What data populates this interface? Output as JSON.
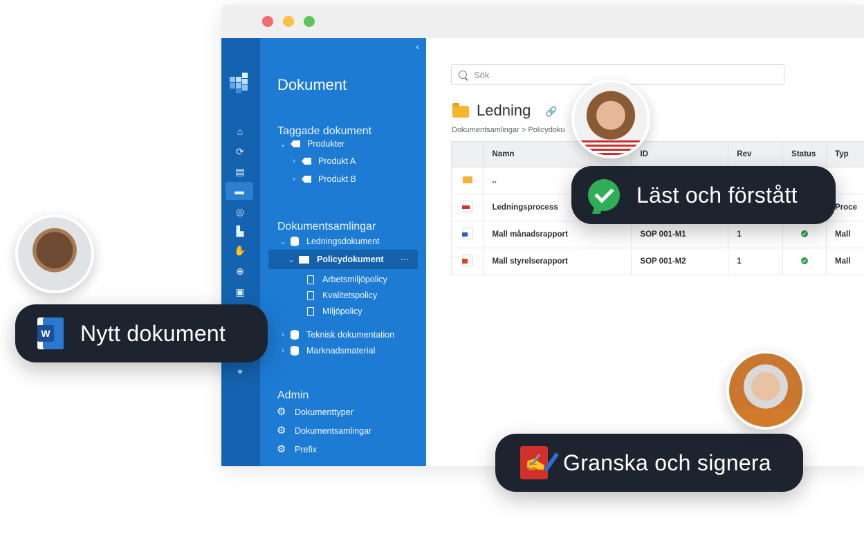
{
  "sidebar": {
    "title": "Dokument",
    "collapse_icon": "‹",
    "tagged": {
      "heading": "Taggade dokument",
      "items": [
        {
          "label": "Produkter"
        },
        {
          "label": "Produkt A"
        },
        {
          "label": "Produkt B"
        }
      ]
    },
    "collections": {
      "heading": "Dokumentsamlingar",
      "items": [
        {
          "label": "Ledningsdokument"
        },
        {
          "label": "Policydokument",
          "more": "···"
        },
        {
          "label": "Arbetsmiljöpolicy"
        },
        {
          "label": "Kvalitetspolicy"
        },
        {
          "label": "Miljöpolicy"
        },
        {
          "label": "Teknisk dokumentation"
        },
        {
          "label": "Marknadsmaterial"
        }
      ]
    },
    "admin": {
      "heading": "Admin",
      "items": [
        {
          "label": "Dokumenttyper"
        },
        {
          "label": "Dokumentsamlingar"
        },
        {
          "label": "Prefix"
        }
      ]
    }
  },
  "search": {
    "placeholder": "Sök"
  },
  "folder": {
    "title": "Ledning",
    "breadcrumb": "Dokumentsamlingar  >  Policydoku"
  },
  "table": {
    "headers": {
      "name": "Namn",
      "id": "ID",
      "rev": "Rev",
      "status": "Status",
      "type": "Typ"
    },
    "rows": [
      {
        "icon": "folder-icon",
        "name": "..",
        "id": "",
        "rev": "",
        "type": ""
      },
      {
        "icon": "pdf-icon",
        "name": "Ledningsprocess",
        "id": "",
        "rev": "",
        "type": "Proce"
      },
      {
        "icon": "word-icon",
        "name": "Mall månadsrapport",
        "id": "SOP 001-M1",
        "rev": "1",
        "type": "Mall"
      },
      {
        "icon": "powerpoint-icon",
        "name": "Mall styrelserapport",
        "id": "SOP 001-M2",
        "rev": "1",
        "type": "Mall"
      }
    ]
  },
  "pills": {
    "new_document": "Nytt dokument",
    "read_understood": "Läst och förstått",
    "review_sign": "Granska och signera"
  },
  "colors": {
    "rail": "#1463b0",
    "sidebar": "#1d7bd4",
    "pill": "#1d2430",
    "status_ok": "#2fa14c"
  }
}
